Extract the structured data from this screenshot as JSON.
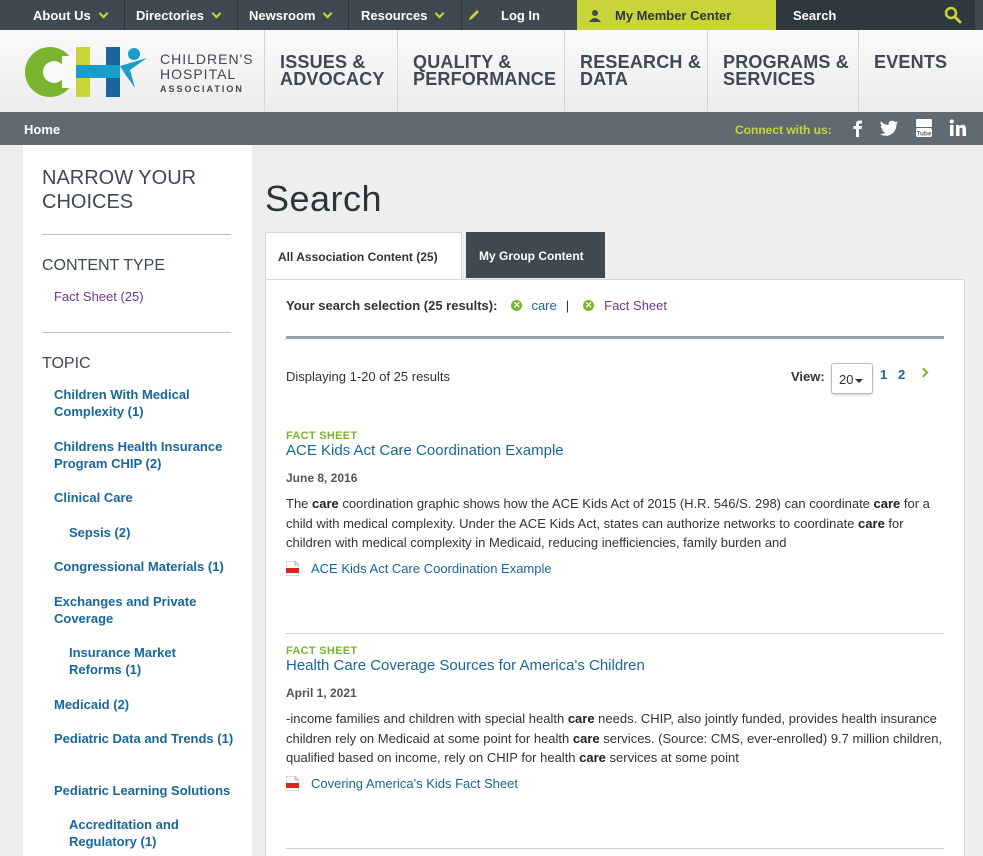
{
  "topnav": {
    "about": "About Us",
    "directories": "Directories",
    "newsroom": "Newsroom",
    "resources": "Resources",
    "login": "Log In",
    "member_center": "My Member Center",
    "search_placeholder": "Search"
  },
  "logo": {
    "line1": "CHILDREN'S",
    "line2": "HOSPITAL",
    "line3": "ASSOCIATION"
  },
  "mainnav": [
    {
      "line1": "ISSUES &",
      "line2": "ADVOCACY"
    },
    {
      "line1": "QUALITY &",
      "line2": "PERFORMANCE"
    },
    {
      "line1": "RESEARCH &",
      "line2": "DATA"
    },
    {
      "line1": "PROGRAMS &",
      "line2": "SERVICES"
    },
    {
      "line1": "EVENTS",
      "line2": ""
    }
  ],
  "breadcrumb": {
    "home": "Home"
  },
  "social": {
    "connect_label": "Connect with us:",
    "icons": [
      "facebook-icon",
      "twitter-icon",
      "youtube-icon",
      "linkedin-icon"
    ]
  },
  "sidebar": {
    "heading_line1": "NARROW YOUR",
    "heading_line2": "CHOICES",
    "content_type_heading": "CONTENT TYPE",
    "content_type_items": [
      "Fact Sheet (25)"
    ],
    "topic_heading": "TOPIC",
    "topics": [
      "Children With Medical Complexity (1)",
      "Childrens Health Insurance Program CHIP (2)",
      "Clinical Care",
      "Sepsis (2)",
      "Congressional Materials (1)",
      "Exchanges and Private Coverage",
      "Insurance Market Reforms (1)",
      "Medicaid (2)",
      "Pediatric Data and Trends (1)",
      "Pediatric Learning Solutions",
      "Accreditation and Regulatory (1)"
    ]
  },
  "main": {
    "title": "Search",
    "tabs": [
      "All Association Content (25)",
      "My Group Content"
    ],
    "selection_label": "Your search selection (25 results):",
    "filters": [
      "care",
      "Fact Sheet"
    ],
    "filter_separator": "|",
    "displaying": "Displaying 1-20 of 25 results",
    "view_label": "View:",
    "view_value": "20",
    "pages": [
      "1",
      "2"
    ],
    "results": [
      {
        "type": "FACT SHEET",
        "title": "ACE Kids Act Care Coordination Example",
        "date": "June 8, 2016",
        "body_html": "The <b>care</b> coordination graphic shows how the ACE Kids Act of 2015 (H.R. 546/S. 298) can coordinate <b>care</b> for a child with medical complexity. Under the ACE Kids Act, states can authorize networks to coordinate <b>care</b> for children with medical complexity in Medicaid, reducing inefficiencies, family burden and",
        "file": "ACE Kids Act Care Coordination Example"
      },
      {
        "type": "FACT SHEET",
        "title": "Health Care Coverage Sources for America's Children",
        "date": "April 1, 2021",
        "body_html": "-income families and children with special health <b>care</b> needs. CHIP, also jointly funded, provides health insurance children rely on Medicaid at some point for health <b>care</b> services. (Source: CMS, ever-enrolled) 9.7 million children, qualified based on income, rely on CHIP for health <b>care</b> services at some point",
        "file": "Covering America's Kids Fact Sheet"
      }
    ]
  },
  "colors": {
    "topbar": "#3e4a4f",
    "accent_green": "#c8d43a",
    "link_blue": "#19679a",
    "fact_green": "#7ab32e",
    "purple": "#6e3a8e",
    "crumbbar": "#5f6b71"
  }
}
